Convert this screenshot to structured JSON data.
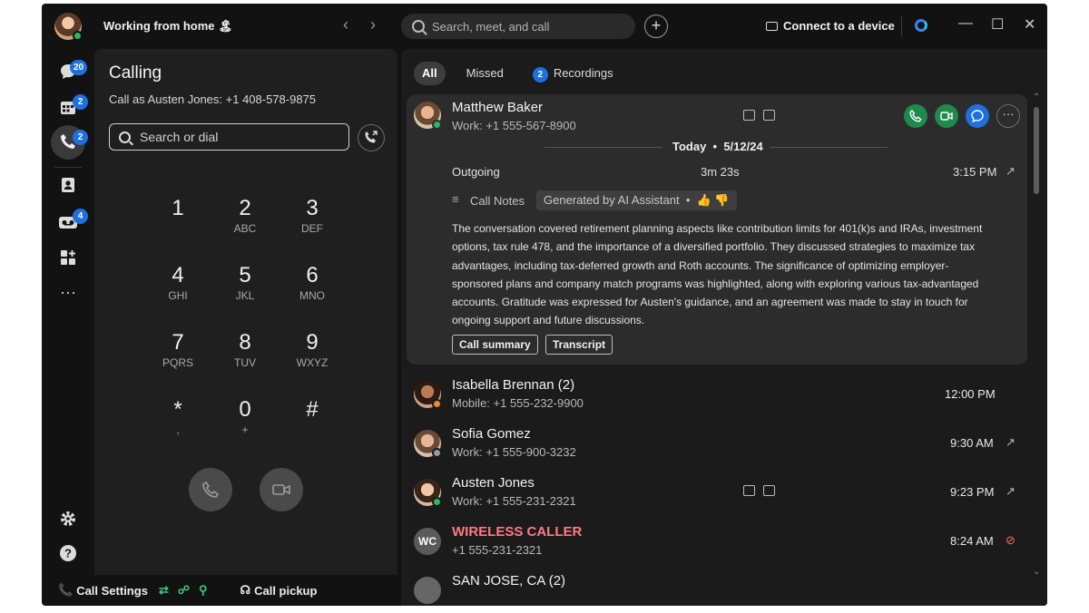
{
  "titlebar": {
    "status": "Working from home 🏝",
    "search_placeholder": "Search, meet, and call",
    "connect_label": "Connect to a device"
  },
  "rail": {
    "badges": {
      "messaging": "20",
      "meetings": "2",
      "calling": "2",
      "voicemail": "4"
    },
    "more": "···"
  },
  "calling": {
    "title": "Calling",
    "call_as": "Call as Austen Jones: +1 408-578-9875",
    "search_placeholder": "Search or dial",
    "keys": [
      {
        "digit": "1",
        "letters": ""
      },
      {
        "digit": "2",
        "letters": "ABC"
      },
      {
        "digit": "3",
        "letters": "DEF"
      },
      {
        "digit": "4",
        "letters": "GHI"
      },
      {
        "digit": "5",
        "letters": "JKL"
      },
      {
        "digit": "6",
        "letters": "MNO"
      },
      {
        "digit": "7",
        "letters": "PQRS"
      },
      {
        "digit": "8",
        "letters": "TUV"
      },
      {
        "digit": "9",
        "letters": "WXYZ"
      },
      {
        "digit": "*",
        "letters": ","
      },
      {
        "digit": "0",
        "letters": "+"
      },
      {
        "digit": "#",
        "letters": ""
      }
    ]
  },
  "bottom": {
    "call_settings": "Call Settings",
    "call_pickup": "Call pickup"
  },
  "filters": {
    "all": "All",
    "missed": "Missed",
    "recordings": "Recordings",
    "recordings_count": "2"
  },
  "expanded": {
    "name": "Matthew Baker",
    "number": "Work: +1 555-567-8900",
    "date_label": "Today",
    "date": "5/12/24",
    "direction": "Outgoing",
    "duration": "3m 23s",
    "time": "3:15 PM",
    "notes_label": "Call Notes",
    "ai_label": "Generated by AI Assistant",
    "summary": "The conversation covered retirement planning aspects like contribution limits for 401(k)s and IRAs, investment options, tax rule 478, and the importance of a diversified portfolio. They discussed strategies to maximize tax advantages, including tax-deferred growth and Roth accounts. The significance of optimizing employer-sponsored plans and company match programs was highlighted, along with exploring various tax-advantaged accounts. Gratitude was expressed for Austen's guidance, and an agreement was made to stay in touch for ongoing support and future discussions.",
    "btn_summary": "Call summary",
    "btn_transcript": "Transcript"
  },
  "history": [
    {
      "name": "Isabella Brennan (2)",
      "number": "Mobile: +1 555-232-9900",
      "time": "12:00 PM"
    },
    {
      "name": "Sofia Gomez",
      "number": "Work: +1 555-900-3232",
      "time": "9:30 AM"
    },
    {
      "name": "Austen Jones",
      "number": "Work: +1 555-231-2321",
      "time": "9:23 PM"
    },
    {
      "name": "WIRELESS CALLER",
      "number": "+1 555-231-2321",
      "time": "8:24 AM",
      "initials": "WC"
    },
    {
      "name": "SAN JOSE, CA (2)",
      "number": "",
      "time": ""
    }
  ],
  "colors": {
    "accent": "#1e6fe0",
    "call_green": "#1f8a4c",
    "missed_red": "#ff6b6b"
  }
}
